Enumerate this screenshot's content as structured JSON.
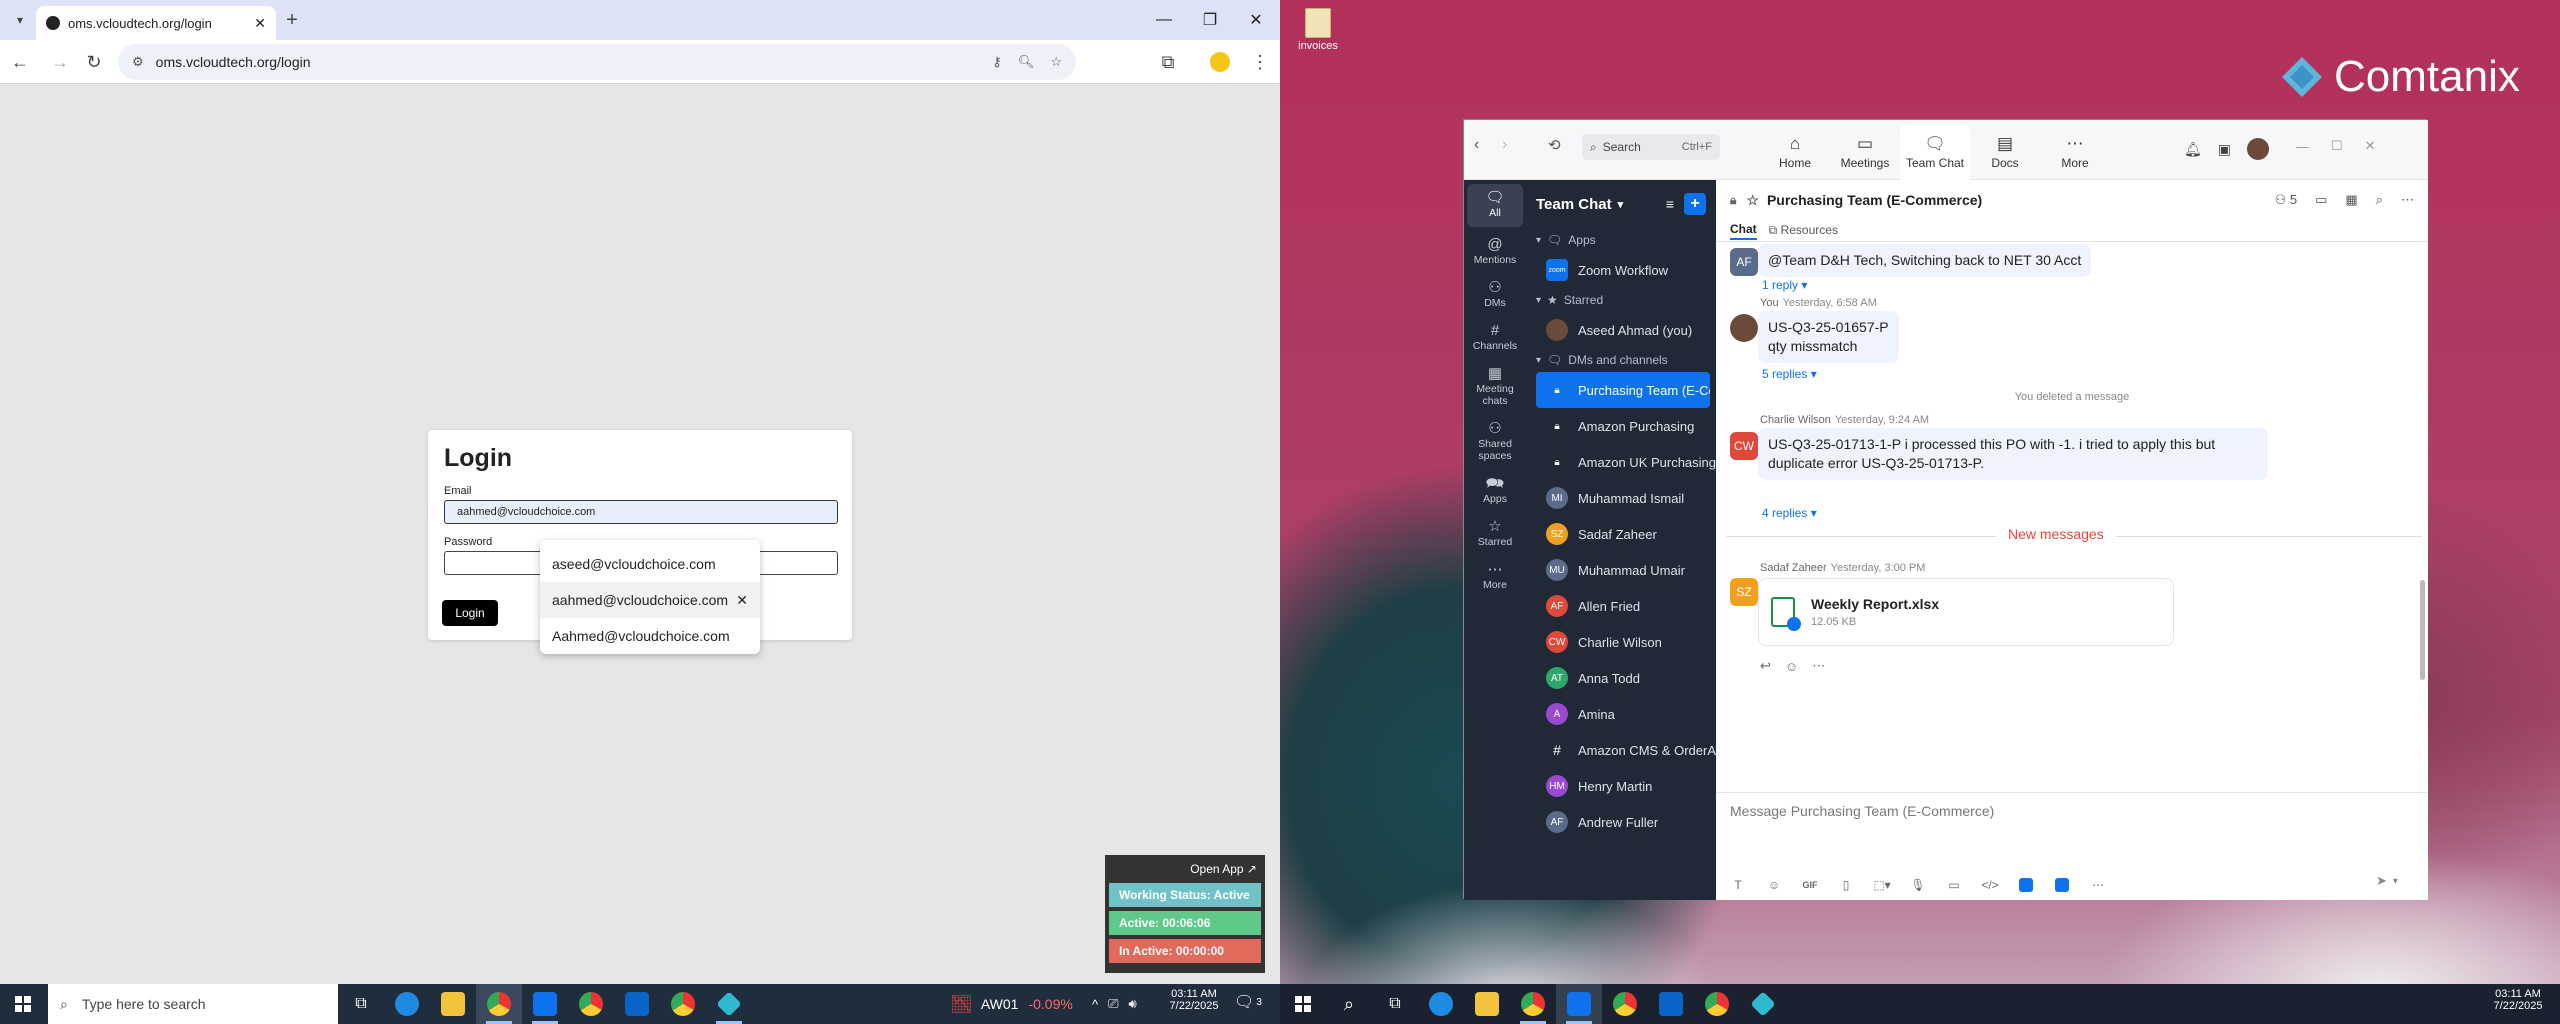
{
  "browser": {
    "tab_title": "oms.vcloudtech.org/login",
    "url": "oms.vcloudtech.org/login"
  },
  "login": {
    "heading": "Login",
    "email_label": "Email",
    "email_value": "aahmed@vcloudchoice.com",
    "password_label": "Password",
    "button_label": "Login"
  },
  "autofill": {
    "options": [
      "aseed@vcloudchoice.com",
      "aahmed@vcloudchoice.com",
      "Aahmed@vcloudchoice.com"
    ]
  },
  "tracker": {
    "open_label": "Open App ↗",
    "status": "Working Status: Active",
    "active": "Active: 00:06:06",
    "inactive": "In Active: 00:00:00",
    "colors": {
      "status": "#6fc3c8",
      "active": "#5fc98a",
      "inactive": "#e26a5c"
    }
  },
  "taskbar_left": {
    "search_placeholder": "Type here to search",
    "stock_name": "AW01",
    "stock_change": "-0.09%",
    "time": "03:11 AM",
    "date": "7/22/2025",
    "notif_count": "3"
  },
  "desktop": {
    "icon_label": "invoices",
    "brand": "Comtanix"
  },
  "zoom": {
    "search": "Search",
    "search_shortcut": "Ctrl+F",
    "nav": [
      "Home",
      "Meetings",
      "Team Chat",
      "Docs",
      "More"
    ],
    "rail": [
      "All",
      "Mentions",
      "DMs",
      "Channels",
      "Meeting chats",
      "Shared spaces",
      "Apps",
      "Starred",
      "More"
    ],
    "list_title": "Team Chat",
    "sections": {
      "apps": "Apps",
      "starred": "Starred",
      "dms": "DMs and channels"
    },
    "zoom_workflow": "Zoom Workflow",
    "starred_item": "Aseed Ahmad (you)",
    "channels": [
      {
        "label": "Purchasing Team (E-Co...",
        "av": "",
        "color": "#0e72ed",
        "kind": "lock"
      },
      {
        "label": "Amazon Purchasing",
        "av": "",
        "color": "#4a5163",
        "kind": "lock"
      },
      {
        "label": "Amazon UK Purchasing",
        "av": "",
        "color": "#4a5163",
        "kind": "lock"
      },
      {
        "label": "Muhammad Ismail",
        "av": "MI",
        "color": "#5a6c8a",
        "kind": "av"
      },
      {
        "label": "Sadaf Zaheer",
        "av": "SZ",
        "color": "#f0a020",
        "kind": "av"
      },
      {
        "label": "Muhammad Umair",
        "av": "MU",
        "color": "#5a6c8a",
        "kind": "av"
      },
      {
        "label": "Allen Fried",
        "av": "AF",
        "color": "#e0483a",
        "kind": "av"
      },
      {
        "label": "Charlie Wilson",
        "av": "CW",
        "color": "#e0483a",
        "kind": "av"
      },
      {
        "label": "Anna Todd",
        "av": "AT",
        "color": "#2ea86a",
        "kind": "av"
      },
      {
        "label": "Amina",
        "av": "A",
        "color": "#9a4ad0",
        "kind": "av"
      },
      {
        "label": "Amazon CMS & OrderA...",
        "av": "#",
        "color": "#4a5163",
        "kind": "hash"
      },
      {
        "label": "Henry Martin",
        "av": "HM",
        "color": "#9a4ad0",
        "kind": "av"
      },
      {
        "label": "Andrew Fuller",
        "av": "AF",
        "color": "#5a6c8a",
        "kind": "av"
      }
    ],
    "channel_title": "Purchasing Team (E-Commerce)",
    "member_count": "5",
    "tab_chat": "Chat",
    "tab_resources": "Resources",
    "messages": {
      "m1_text": "@Team D&H Tech, Switching back to NET 30 Acct",
      "m1_replies": "1 reply",
      "m2_sender": "You",
      "m2_time": "Yesterday, 6:58 AM",
      "m2_line1": "US-Q3-25-01657-P",
      "m2_line2": "qty missmatch",
      "m2_replies": "5 replies",
      "deleted": "You deleted a message",
      "m3_sender": "Charlie Wilson",
      "m3_time": "Yesterday, 9:24 AM",
      "m3_text": "US-Q3-25-01713-1-P i processed this PO with -1. i tried to apply this but duplicate error US-Q3-25-01713-P.",
      "m3_replies": "4 replies",
      "new_messages": "New messages",
      "m4_sender": "Sadaf Zaheer",
      "m4_time": "Yesterday, 3:00 PM",
      "file_name": "Weekly Report.xlsx",
      "file_size": "12.05 KB"
    },
    "composer_placeholder": "Message Purchasing Team (E-Commerce)"
  },
  "taskbar_right": {
    "time": "03:11 AM",
    "date": "7/22/2025"
  }
}
